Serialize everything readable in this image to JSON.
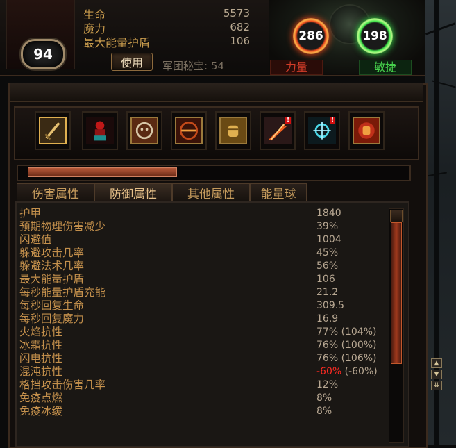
{
  "character": {
    "level": "94",
    "stats": [
      {
        "label": "生命",
        "value": "5573"
      },
      {
        "label": "魔力",
        "value": "682"
      },
      {
        "label": "最大能量护盾",
        "value": "106"
      }
    ],
    "use_button": "使用",
    "legion_treasure": "军团秘宝: 54",
    "strength": {
      "value": "286",
      "label": "力量"
    },
    "dexterity": {
      "value": "198",
      "label": "敏捷"
    }
  },
  "skills": [
    {
      "icon": "sword-icon"
    },
    {
      "icon": "red-warrior-icon"
    },
    {
      "icon": "skeleton-icon"
    },
    {
      "icon": "crossbow-icon"
    },
    {
      "icon": "fist-icon"
    },
    {
      "icon": "fire-slash-icon",
      "alert": "!"
    },
    {
      "icon": "lightning-burst-icon",
      "alert": "!"
    },
    {
      "icon": "red-fist-icon"
    }
  ],
  "progress": {
    "fraction": 0.38
  },
  "tabs": [
    {
      "label": "伤害属性"
    },
    {
      "label": "防御属性"
    },
    {
      "label": "其他属性"
    },
    {
      "label": "能量球"
    }
  ],
  "active_tab": "防御属性",
  "defense_stats": [
    {
      "label": "护甲",
      "value": "1840"
    },
    {
      "label": "预期物理伤害减少",
      "value": "39%"
    },
    {
      "label": "闪避值",
      "value": "1004"
    },
    {
      "label": "躲避攻击几率",
      "value": "45%"
    },
    {
      "label": "躲避法术几率",
      "value": "56%"
    },
    {
      "label": "最大能量护盾",
      "value": "106"
    },
    {
      "label": "每秒能量护盾充能",
      "value": "21.2"
    },
    {
      "label": "每秒回复生命",
      "value": "309.5"
    },
    {
      "label": "每秒回复魔力",
      "value": "16.9"
    },
    {
      "label": "火焰抗性",
      "value": "77% (104%)"
    },
    {
      "label": "冰霜抗性",
      "value": "76% (100%)"
    },
    {
      "label": "闪电抗性",
      "value": "76% (106%)"
    },
    {
      "label": "混沌抗性",
      "value": "-60%",
      "value_extra": " (-60%)"
    },
    {
      "label": "格挡攻击伤害几率",
      "value": "12%"
    },
    {
      "label": "免疫点燃",
      "value": "8%"
    },
    {
      "label": "免疫冰缓",
      "value": "8%"
    }
  ],
  "colors": {
    "label_gold": "#c4904c",
    "value_gray": "#b7a792",
    "negative_red": "#ff2a22",
    "strength_red": "#d23c28",
    "dexterity_green": "#46d04c"
  }
}
